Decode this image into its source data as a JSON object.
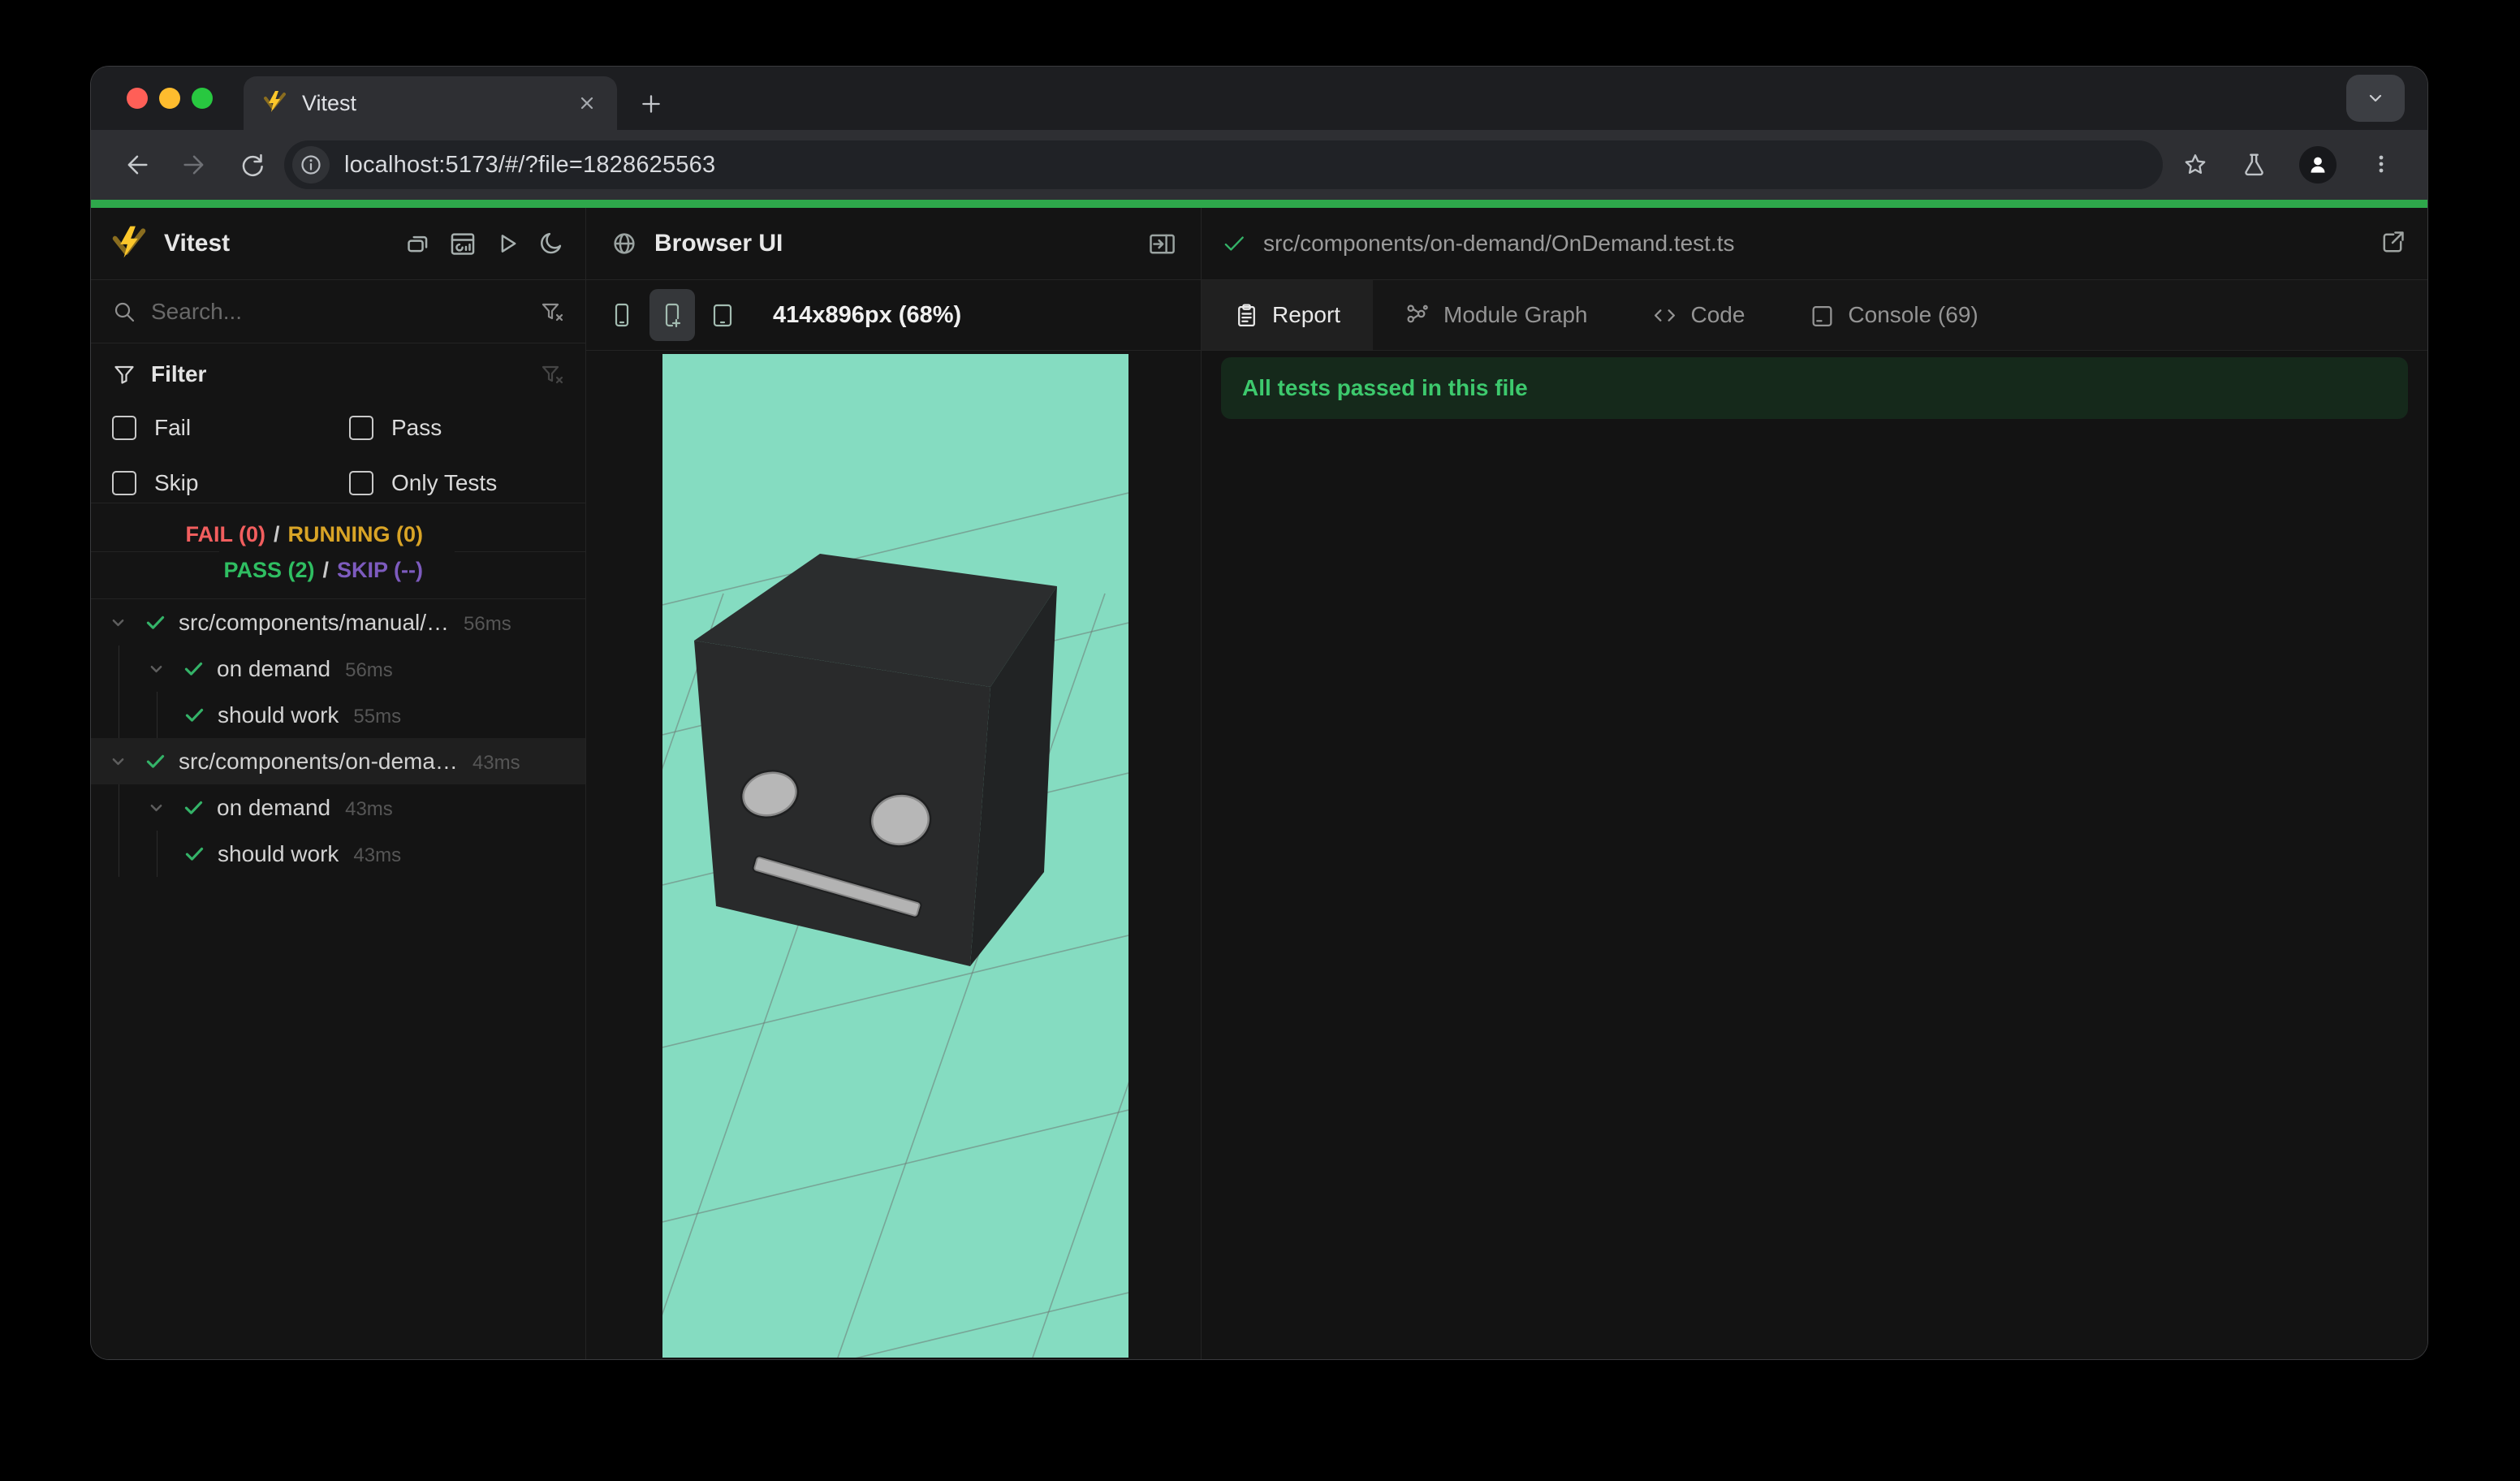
{
  "colors": {
    "progress_green": "#2ea84b",
    "fail_red": "#f25e5e",
    "running_yellow": "#d9a426",
    "pass_green": "#2fbe62",
    "skip_purple": "#7d5bbe",
    "check_green": "#34b368",
    "viewport_teal": "#85dcc1",
    "banner_bg": "#15291b",
    "banner_text": "#3dc96d"
  },
  "browser": {
    "tab_title": "Vitest",
    "url": "localhost:5173/#/?file=1828625563"
  },
  "sidebar": {
    "title": "Vitest",
    "search_placeholder": "Search...",
    "filter": {
      "title": "Filter",
      "options": [
        "Fail",
        "Pass",
        "Skip",
        "Only Tests"
      ]
    },
    "status": {
      "fail": "FAIL (0)",
      "running": "RUNNING (0)",
      "pass": "PASS (2)",
      "skip": "SKIP (--)",
      "separator": "/"
    },
    "tree": [
      {
        "level": 0,
        "expandable": true,
        "name": "src/components/manual/…",
        "duration": "56ms",
        "selected": false
      },
      {
        "level": 1,
        "expandable": true,
        "name": "on demand",
        "duration": "56ms",
        "selected": false
      },
      {
        "level": 2,
        "expandable": false,
        "name": "should work",
        "duration": "55ms",
        "selected": false
      },
      {
        "level": 0,
        "expandable": true,
        "name": "src/components/on-dema…",
        "duration": "43ms",
        "selected": true
      },
      {
        "level": 1,
        "expandable": true,
        "name": "on demand",
        "duration": "43ms",
        "selected": false
      },
      {
        "level": 2,
        "expandable": false,
        "name": "should work",
        "duration": "43ms",
        "selected": false
      }
    ]
  },
  "middle": {
    "title": "Browser UI",
    "size_label": "414x896px (68%)"
  },
  "right": {
    "file_path": "src/components/on-demand/OnDemand.test.ts",
    "tabs": [
      {
        "label": "Report",
        "active": true
      },
      {
        "label": "Module Graph",
        "active": false
      },
      {
        "label": "Code",
        "active": false
      },
      {
        "label": "Console (69)",
        "active": false
      }
    ],
    "banner": "All tests passed in this file"
  }
}
